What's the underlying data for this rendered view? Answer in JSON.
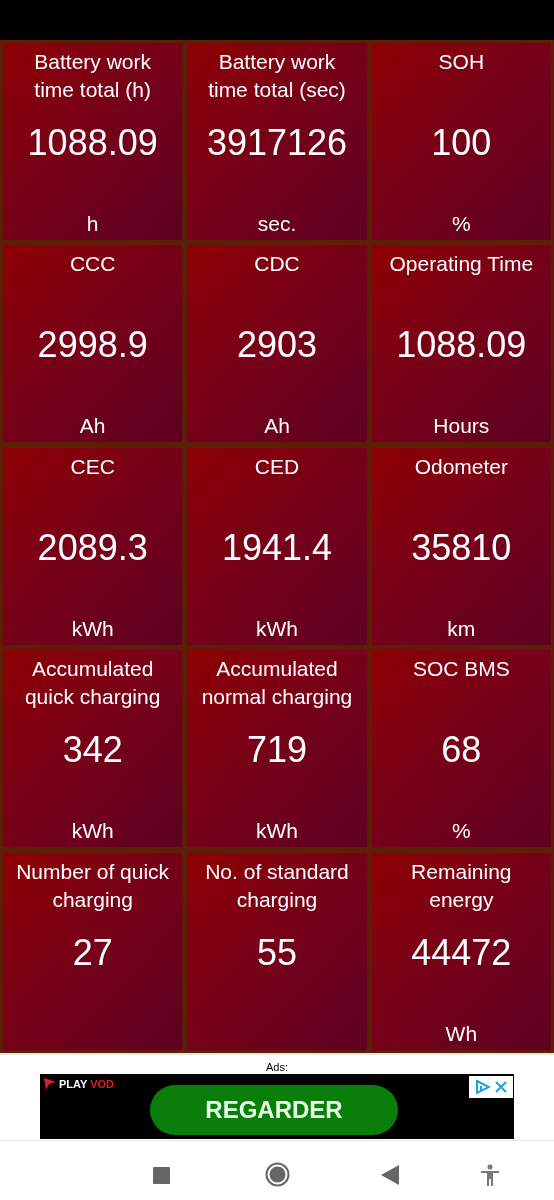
{
  "tiles": [
    {
      "title": "Battery work time total (h)",
      "value": "1088.09",
      "unit": "h"
    },
    {
      "title": "Battery work time total (sec)",
      "value": "3917126",
      "unit": "sec."
    },
    {
      "title": "SOH",
      "value": "100",
      "unit": "%"
    },
    {
      "title": "CCC",
      "value": "2998.9",
      "unit": "Ah"
    },
    {
      "title": "CDC",
      "value": "2903",
      "unit": "Ah"
    },
    {
      "title": "Operating Time",
      "value": "1088.09",
      "unit": "Hours"
    },
    {
      "title": "CEC",
      "value": "2089.3",
      "unit": "kWh"
    },
    {
      "title": "CED",
      "value": "1941.4",
      "unit": "kWh"
    },
    {
      "title": "Odometer",
      "value": "35810",
      "unit": "km"
    },
    {
      "title": "Accumulated quick charging",
      "value": "342",
      "unit": "kWh"
    },
    {
      "title": "Accumulated normal charging",
      "value": "719",
      "unit": "kWh"
    },
    {
      "title": "SOC BMS",
      "value": "68",
      "unit": "%"
    },
    {
      "title": "Number of quick charging",
      "value": "27"
    },
    {
      "title": "No. of standard charging",
      "value": "55"
    },
    {
      "title": "Remaining energy",
      "value": "44472",
      "unit": "Wh"
    }
  ],
  "ad": {
    "label": "Ads:",
    "brand_left": "PLAY",
    "brand_right": "VOD",
    "button": "REGARDER"
  }
}
